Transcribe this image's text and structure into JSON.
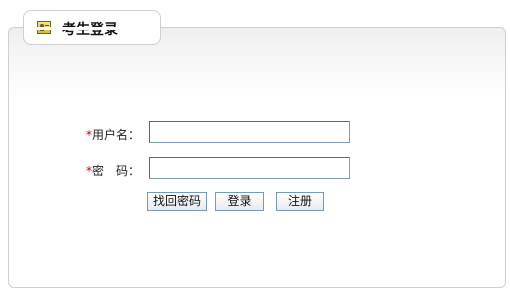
{
  "tab": {
    "title": "考生登录",
    "icon": "id-card-icon"
  },
  "form": {
    "username": {
      "required_mark": "*",
      "label": "用户名：",
      "value": "",
      "placeholder": ""
    },
    "password": {
      "required_mark": "*",
      "label": "密　码：",
      "value": "",
      "placeholder": ""
    }
  },
  "buttons": {
    "forgot": "找回密码",
    "login": "登录",
    "register": "注册"
  },
  "colors": {
    "required": "#cc0000",
    "border": "#cfcfcf",
    "input_border": "#7f9db9"
  }
}
